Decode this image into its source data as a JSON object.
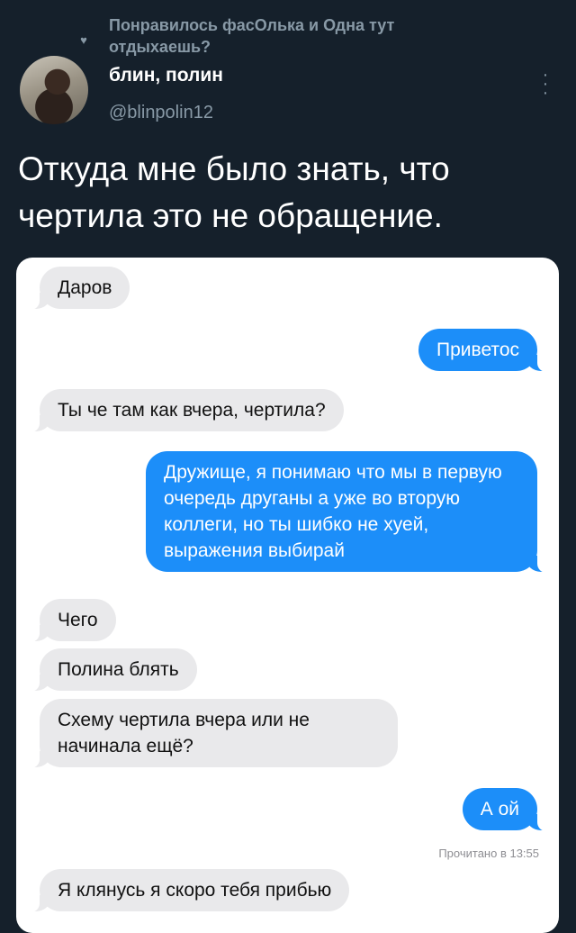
{
  "liked_by": "Понравилось фасОлька и Одна тут отдыхаешь?",
  "author": {
    "display_name": "блин, полин",
    "handle": "@blinpolin12"
  },
  "tweet_text": "Откуда мне было знать, что чертила это не обращение.",
  "chat": {
    "messages": [
      {
        "direction": "in",
        "text": "Даров"
      },
      {
        "direction": "out",
        "text": "Приветос"
      },
      {
        "direction": "in",
        "text": "Ты че там как вчера, чертила?"
      },
      {
        "direction": "out",
        "text": "Дружище, я понимаю что мы в первую очередь друганы а уже во вторую коллеги, но ты шибко не хуей, выражения выбирай"
      },
      {
        "direction": "in",
        "text": "Чего"
      },
      {
        "direction": "in",
        "text": "Полина блять"
      },
      {
        "direction": "in",
        "text": "Схему чертила вчера или не начинала ещё?"
      },
      {
        "direction": "out",
        "text": "А ой"
      },
      {
        "direction": "in",
        "text": "Я клянусь я скоро тебя прибью"
      }
    ],
    "read_receipt": "Прочитано в 13:55"
  },
  "icons": {
    "liked": "heart-icon",
    "more": "more-vertical-icon"
  }
}
